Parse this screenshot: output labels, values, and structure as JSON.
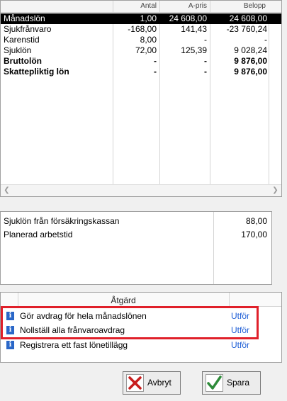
{
  "grid": {
    "columns": {
      "antal": "Antal",
      "apris": "A-pris",
      "belopp": "Belopp"
    },
    "rows": [
      {
        "name": "Månadslön",
        "antal": "1,00",
        "apris": "24 608,00",
        "belopp": "24 608,00"
      },
      {
        "name": "Sjukfrånvaro",
        "antal": "-168,00",
        "apris": "141,43",
        "belopp": "-23 760,24"
      },
      {
        "name": "Karenstid",
        "antal": "8,00",
        "apris": "-",
        "belopp": "-"
      },
      {
        "name": "Sjuklön",
        "antal": "72,00",
        "apris": "125,39",
        "belopp": "9 028,24"
      },
      {
        "name": "Bruttolön",
        "antal": "-",
        "apris": "-",
        "belopp": "9 876,00"
      },
      {
        "name": "Skattepliktig lön",
        "antal": "-",
        "apris": "-",
        "belopp": "9 876,00"
      }
    ]
  },
  "info": {
    "rows": [
      {
        "label": "Sjuklön från försäkringskassan",
        "value": "88,00"
      },
      {
        "label": "Planerad arbetstid",
        "value": "170,00"
      }
    ]
  },
  "actions": {
    "header": "Åtgärd",
    "rows": [
      {
        "label": "Gör avdrag för hela månadslönen",
        "link": "Utför"
      },
      {
        "label": "Nollställ alla frånvaroavdrag",
        "link": "Utför"
      },
      {
        "label": "Registrera ett fast lönetillägg",
        "link": "Utför"
      }
    ]
  },
  "buttons": {
    "cancel": "Avbryt",
    "save": "Spara"
  },
  "colors": {
    "highlight": "#e0202a",
    "link": "#1f5fd6",
    "selected_row": "#000000",
    "info_icon": "#2a67c8"
  }
}
